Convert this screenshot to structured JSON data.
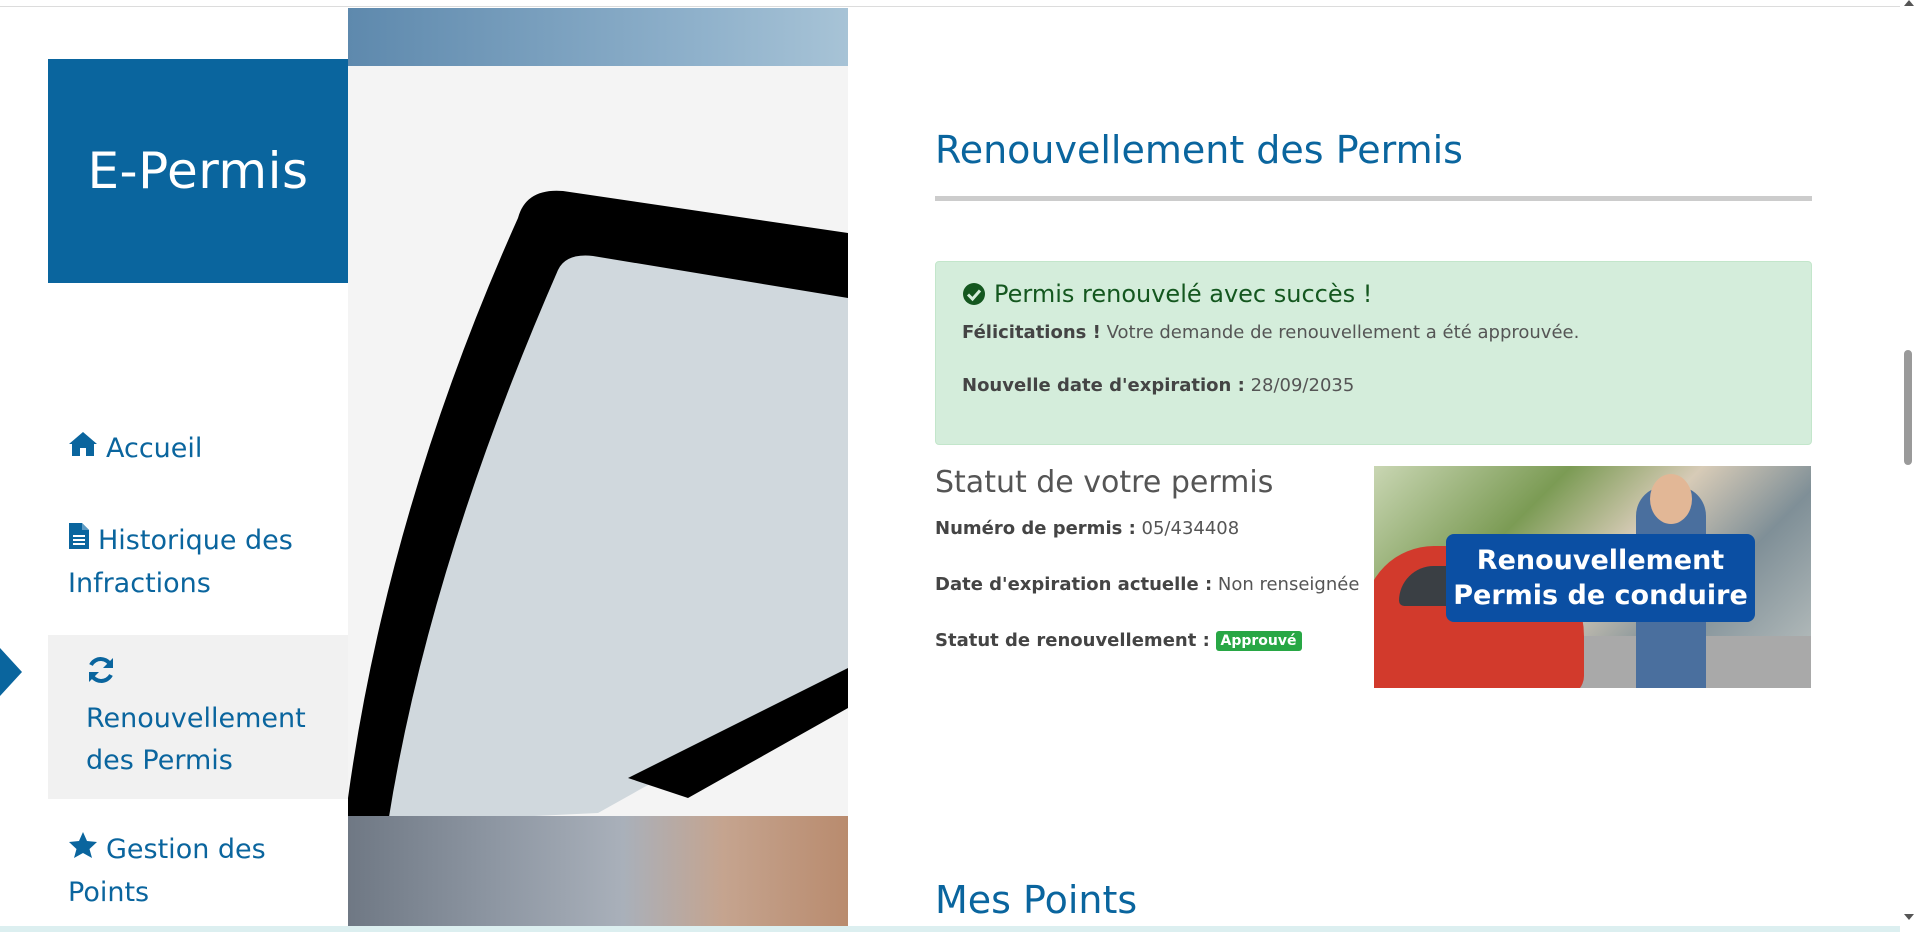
{
  "brand": {
    "name": "E-Permis"
  },
  "sidebar": {
    "items": [
      {
        "label": "Accueil",
        "icon": "home-icon"
      },
      {
        "label": "Historique des Infractions",
        "icon": "file-icon"
      },
      {
        "label": "Renouvellement des Permis",
        "icon": "refresh-icon",
        "active": true
      },
      {
        "label": "Gestion des Points",
        "icon": "star-icon"
      }
    ]
  },
  "renewal": {
    "title": "Renouvellement des Permis",
    "alert": {
      "title": "Permis renouvelé avec succès !",
      "congrats_label": "Félicitations !",
      "congrats_text": "Votre demande de renouvellement a été approuvée.",
      "expiry_label": "Nouvelle date d'expiration :",
      "expiry_value": "28/09/2035"
    },
    "status": {
      "title": "Statut de votre permis",
      "permit_number_label": "Numéro de permis :",
      "permit_number_value": "05/434408",
      "current_expiry_label": "Date d'expiration actuelle :",
      "current_expiry_value": "Non renseignée",
      "renewal_status_label": "Statut de renouvellement :",
      "renewal_status_value": "Approuvé"
    },
    "promo": {
      "line1": "Renouvellement",
      "line2": "Permis de conduire"
    }
  },
  "points": {
    "title": "Mes Points"
  },
  "colors": {
    "primary": "#0a659e",
    "success_bg": "#d4eddb",
    "success_text": "#14571f",
    "badge_green": "#28a745",
    "promo_blue": "#0b4fa3"
  }
}
